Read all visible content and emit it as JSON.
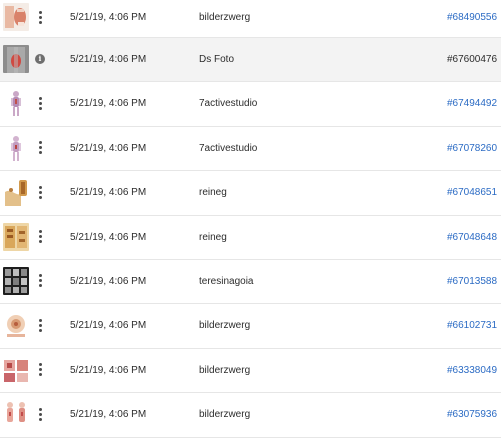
{
  "rows": [
    {
      "date": "5/21/19, 4:06 PM",
      "author": "bilderzwerg",
      "id": "#68490556",
      "id_link": true,
      "action_icon": "more-vertical-icon",
      "thumbnail": "anatomy-chart-thumbnail",
      "highlight": false
    },
    {
      "date": "5/21/19, 4:06 PM",
      "author": "Ds Foto",
      "id": "#67600476",
      "id_link": false,
      "action_icon": "info-icon",
      "thumbnail": "back-pain-photo-thumbnail",
      "highlight": true
    },
    {
      "date": "5/21/19, 4:06 PM",
      "author": "7activestudio",
      "id": "#67494492",
      "id_link": true,
      "action_icon": "more-vertical-icon",
      "thumbnail": "human-body-figure-thumbnail",
      "highlight": false
    },
    {
      "date": "5/21/19, 4:06 PM",
      "author": "7activestudio",
      "id": "#67078260",
      "id_link": true,
      "action_icon": "more-vertical-icon",
      "thumbnail": "human-body-figure-thumbnail",
      "highlight": false
    },
    {
      "date": "5/21/19, 4:06 PM",
      "author": "reineg",
      "id": "#67048651",
      "id_link": true,
      "action_icon": "more-vertical-icon",
      "thumbnail": "spine-illustration-thumbnail",
      "highlight": false
    },
    {
      "date": "5/21/19, 4:06 PM",
      "author": "reineg",
      "id": "#67048648",
      "id_link": true,
      "action_icon": "more-vertical-icon",
      "thumbnail": "spine-chart-thumbnail",
      "highlight": false
    },
    {
      "date": "5/21/19, 4:06 PM",
      "author": "teresinagoia",
      "id": "#67013588",
      "id_link": true,
      "action_icon": "more-vertical-icon",
      "thumbnail": "xray-grid-thumbnail",
      "highlight": false
    },
    {
      "date": "5/21/19, 4:06 PM",
      "author": "bilderzwerg",
      "id": "#66102731",
      "id_link": true,
      "action_icon": "more-vertical-icon",
      "thumbnail": "anatomy-diagram-thumbnail",
      "highlight": false
    },
    {
      "date": "5/21/19, 4:06 PM",
      "author": "bilderzwerg",
      "id": "#63338049",
      "id_link": true,
      "action_icon": "more-vertical-icon",
      "thumbnail": "anatomy-comparison-thumbnail",
      "highlight": false
    },
    {
      "date": "5/21/19, 4:06 PM",
      "author": "bilderzwerg",
      "id": "#63075936",
      "id_link": true,
      "action_icon": "more-vertical-icon",
      "thumbnail": "anatomy-figures-thumbnail",
      "highlight": false
    }
  ],
  "colors": {
    "link": "#2b6bc4",
    "text": "#2c2c2c",
    "highlight_row": "#f3f3f3",
    "divider": "#e6e6e6"
  }
}
